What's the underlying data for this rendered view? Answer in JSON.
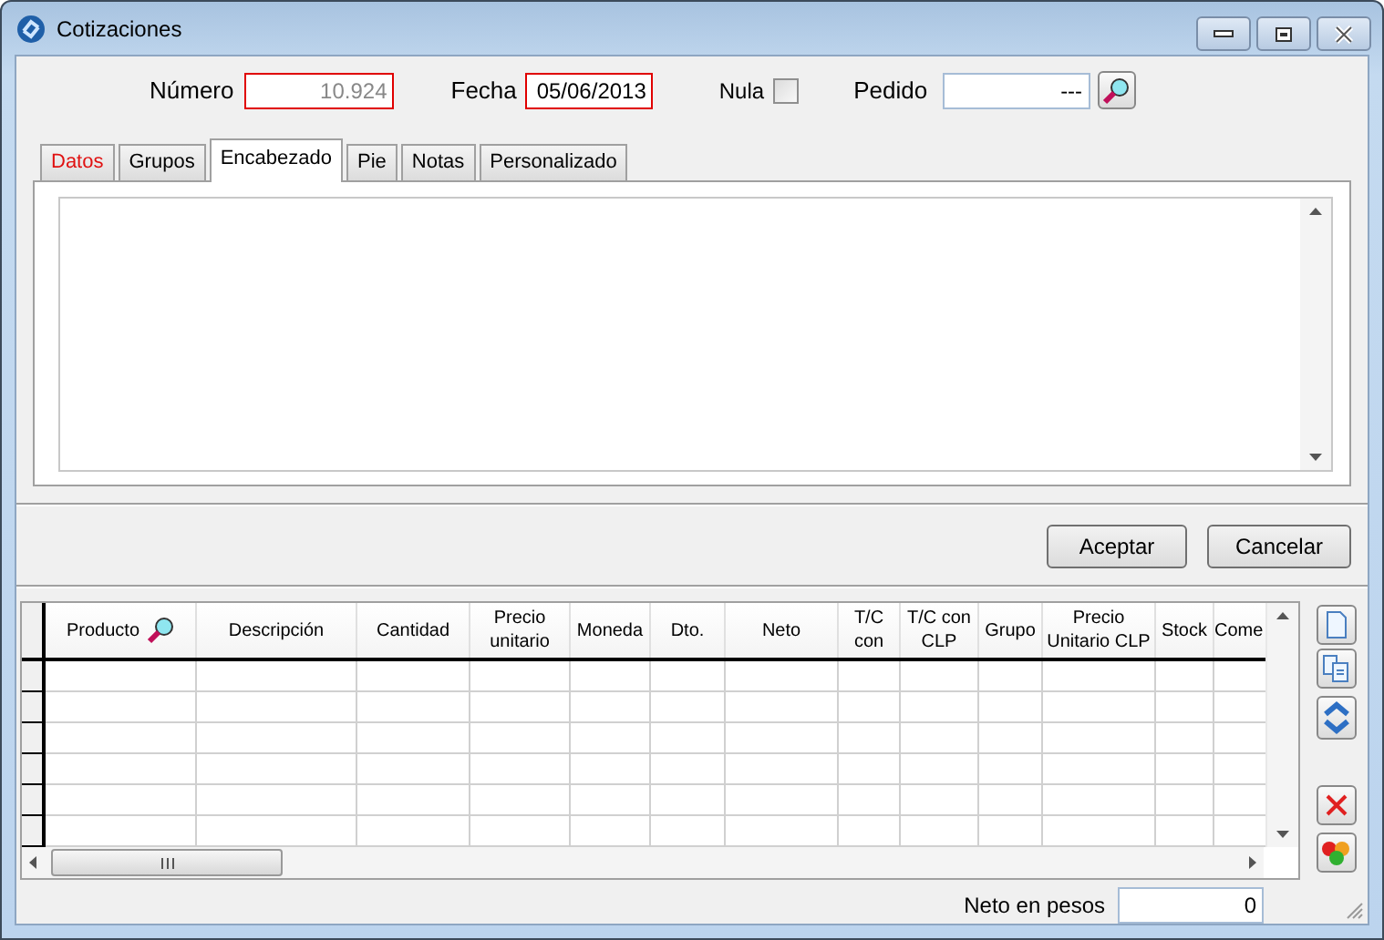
{
  "window": {
    "title": "Cotizaciones"
  },
  "header": {
    "numero": {
      "label": "Número",
      "value": "10.924",
      "invalid": true,
      "readonly": true
    },
    "fecha": {
      "label": "Fecha",
      "value": "05/06/2013",
      "invalid": true,
      "readonly": false
    },
    "nula": {
      "label": "Nula",
      "checked": false
    },
    "pedido": {
      "label": "Pedido",
      "value": "---",
      "invalid": false,
      "readonly": false
    }
  },
  "tabs": [
    {
      "label": "Datos",
      "selected": false,
      "alert": true
    },
    {
      "label": "Grupos",
      "selected": false,
      "alert": false
    },
    {
      "label": "Encabezado",
      "selected": true,
      "alert": false
    },
    {
      "label": "Pie",
      "selected": false,
      "alert": false
    },
    {
      "label": "Notas",
      "selected": false,
      "alert": false
    },
    {
      "label": "Personalizado",
      "selected": false,
      "alert": false
    }
  ],
  "buttons": [
    "Aceptar",
    "Cancelar"
  ],
  "table": {
    "columns": [
      "Producto",
      "Descripción",
      "Cantidad",
      "Precio unitario",
      "Moneda",
      "Dto.",
      "Neto",
      "T/C con",
      "T/C con CLP",
      "Grupo",
      "Precio Unitario CLP",
      "Stock",
      "Come"
    ]
  },
  "footer": {
    "label": "Neto en pesos",
    "value": "0"
  }
}
